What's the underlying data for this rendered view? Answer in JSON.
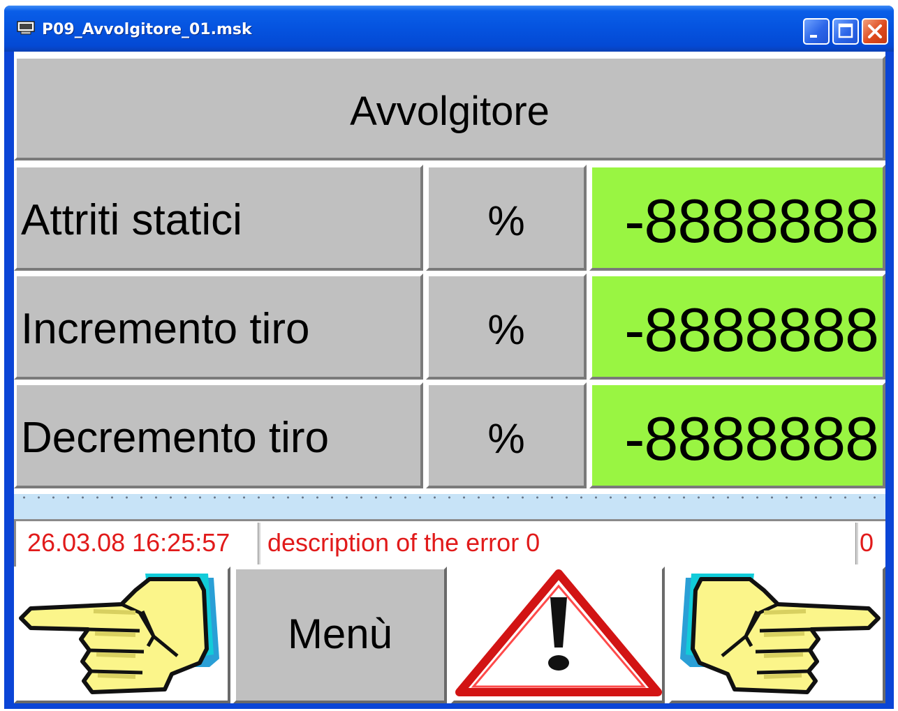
{
  "window": {
    "title": "P09_Avvolgitore_01.msk",
    "controls": [
      "minimize",
      "maximize",
      "close"
    ]
  },
  "header": {
    "title": "Avvolgitore"
  },
  "rows": [
    {
      "label": "Attriti statici",
      "unit": "%",
      "value": "-8888888"
    },
    {
      "label": "Incremento tiro",
      "unit": "%",
      "value": "-8888888"
    },
    {
      "label": "Decremento tiro",
      "unit": "%",
      "value": "-8888888"
    }
  ],
  "status_bar": {
    "timestamp": "26.03.08 16:25:57",
    "message": "description of the error 0",
    "code": "0"
  },
  "buttons": {
    "prev_icon": "hand-pointing-left-icon",
    "menu_label": "Menù",
    "alarm_icon": "warning-triangle-icon",
    "next_icon": "hand-pointing-right-icon"
  },
  "colors": {
    "panel_gray": "#c0c0c0",
    "value_green": "#99f542",
    "error_red": "#e11a1a",
    "titlebar_blue": "#0553df",
    "stripe_blue": "#c7e3f7"
  }
}
